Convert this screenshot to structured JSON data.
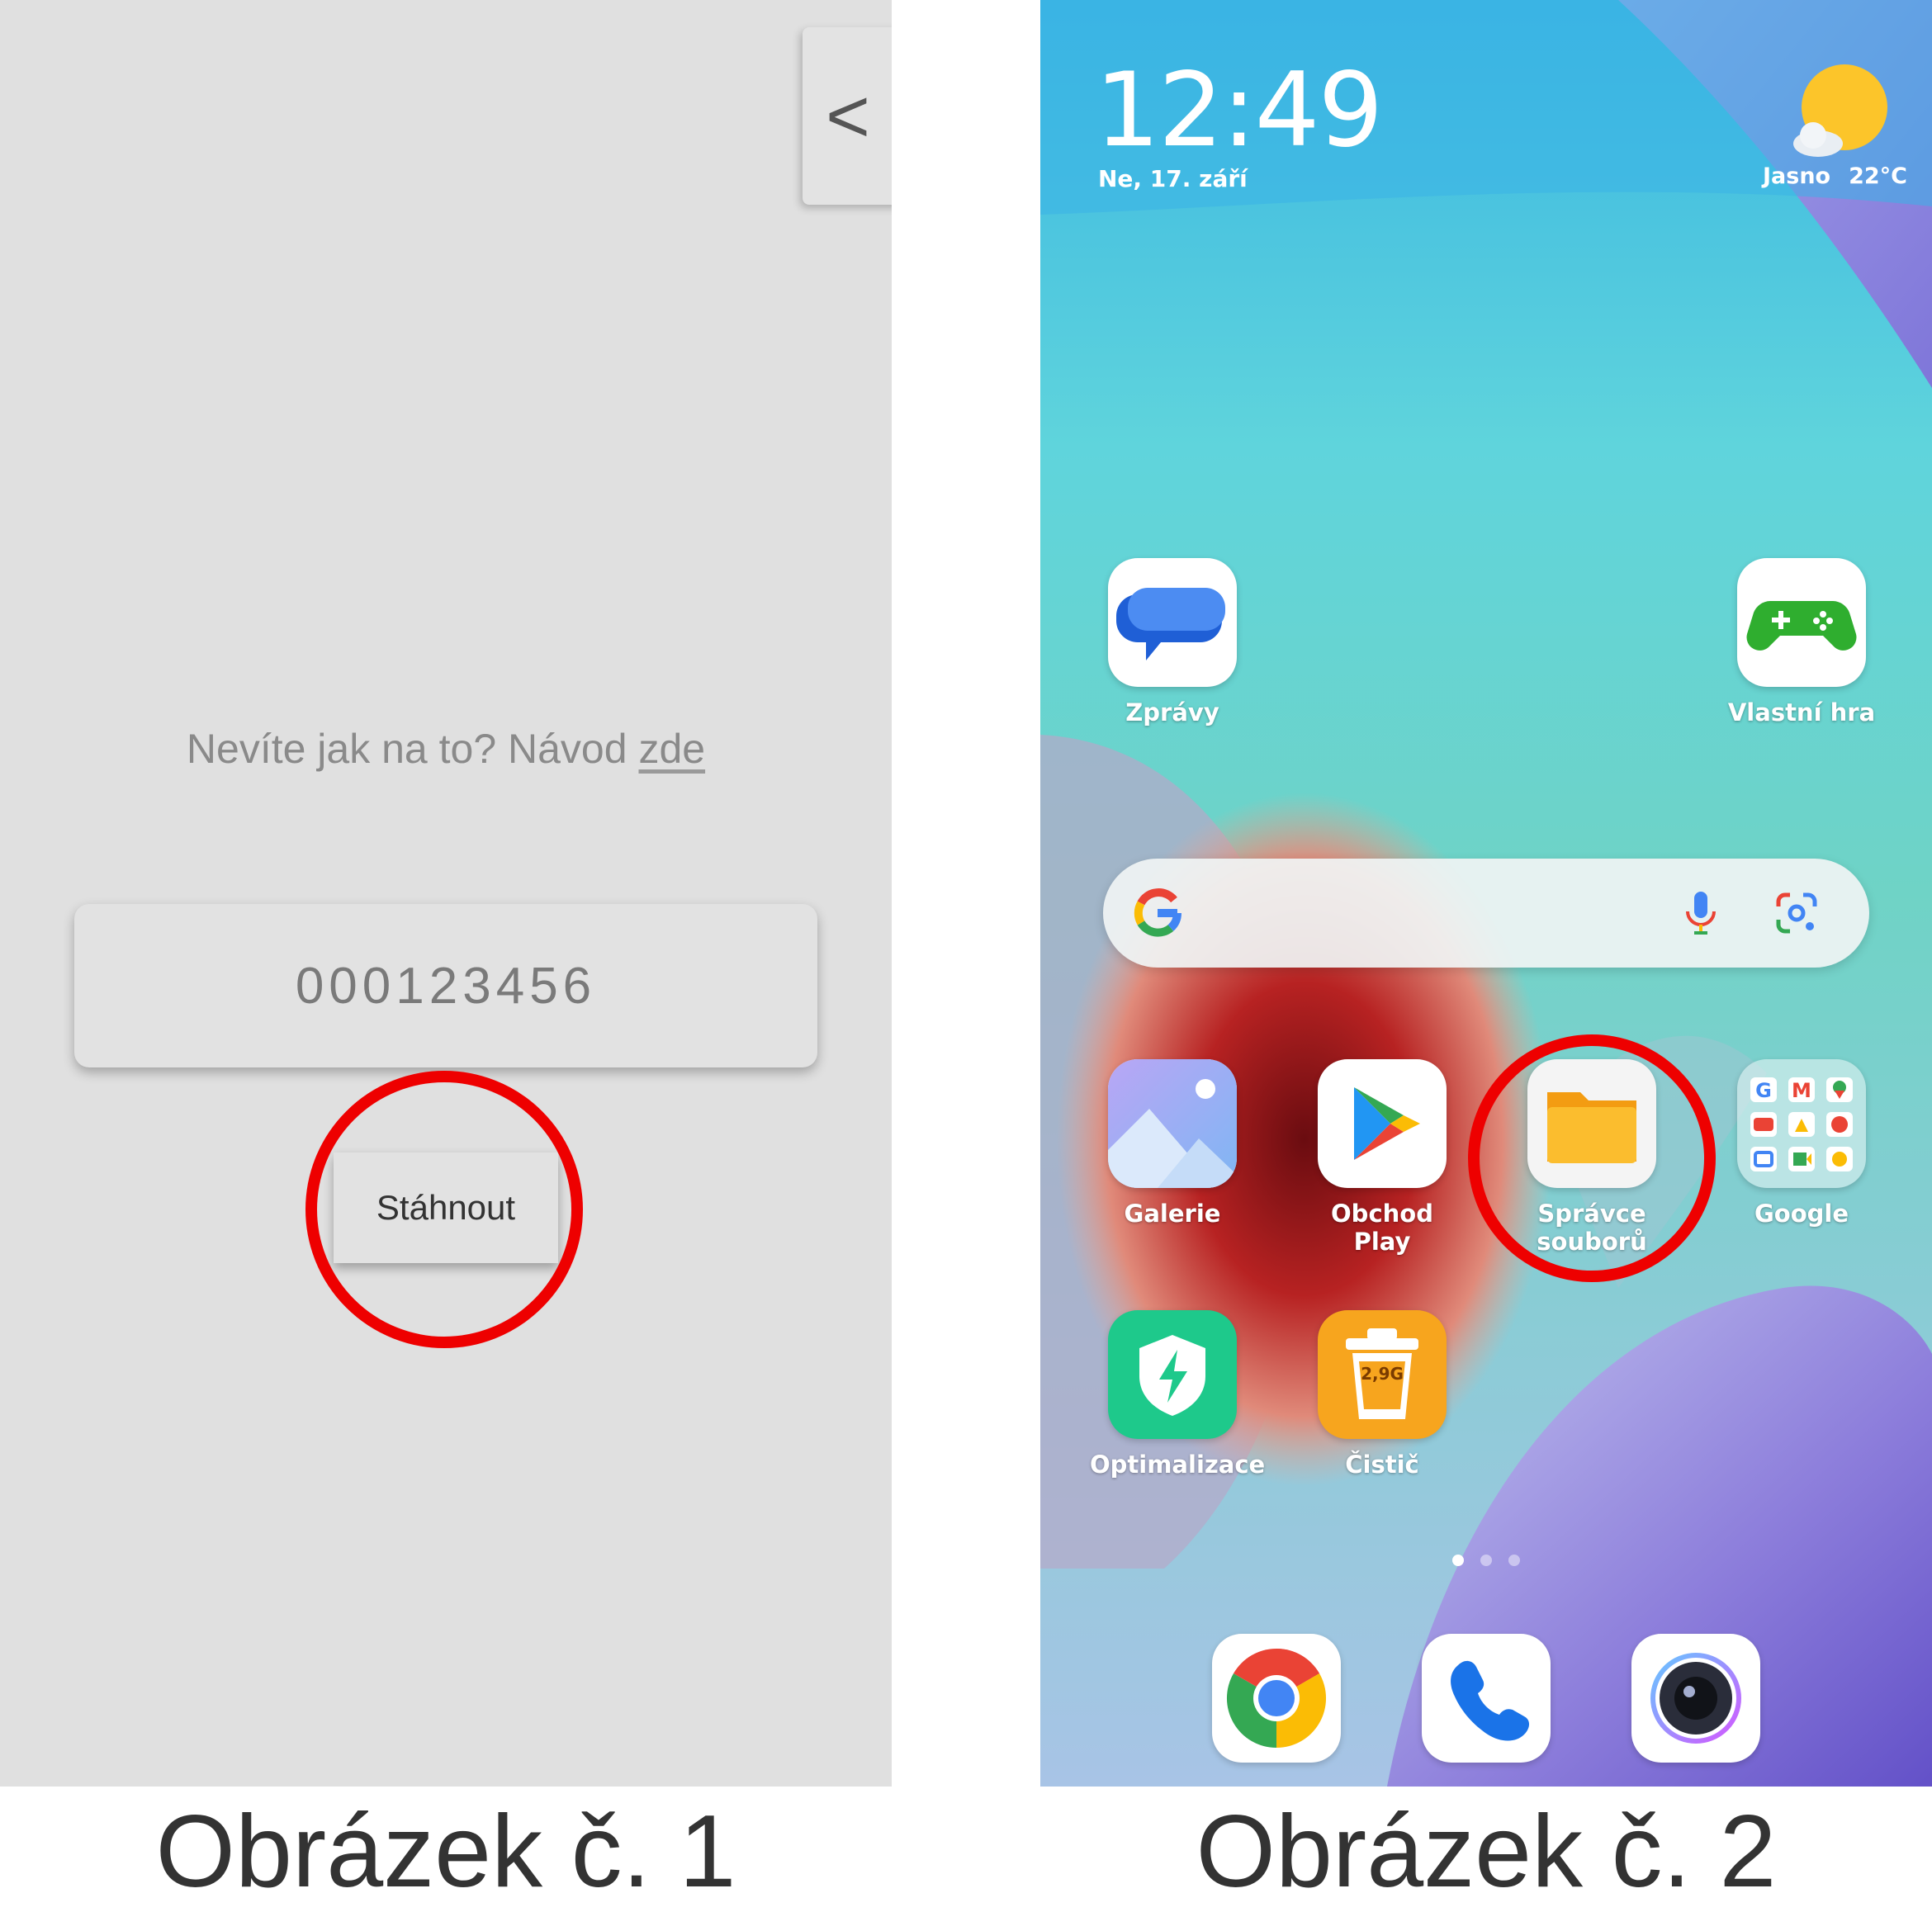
{
  "panel1": {
    "back_button": "<",
    "help_text": "Nevíte jak na to? Návod ",
    "help_link": "zde",
    "code_value": "000123456",
    "download_button": "Stáhnout",
    "highlight_color": "#ee0000",
    "caption": "Obrázek č. 1"
  },
  "panel2": {
    "status": {
      "time": "12:49",
      "date": "Ne, 17. září",
      "weather": "Jasno",
      "temperature": "22°C"
    },
    "apps_row1": [
      {
        "label": "Zprávy",
        "icon": "messages-icon"
      },
      {
        "label": "Vlastní hra",
        "icon": "gamepad-icon"
      }
    ],
    "search": {
      "icons": [
        "google-g-icon",
        "microphone-icon",
        "lens-icon"
      ]
    },
    "apps_row2": [
      {
        "label": "Galerie",
        "icon": "gallery-icon"
      },
      {
        "label": "Obchod Play",
        "icon": "play-store-icon"
      },
      {
        "label": "Správce souborů",
        "icon": "folder-icon"
      },
      {
        "label": "Google",
        "icon": "google-folder-icon"
      }
    ],
    "apps_row3": [
      {
        "label": "Optimalizace",
        "icon": "shield-bolt-icon"
      },
      {
        "label": "Čistič",
        "icon": "trash-icon",
        "badge": "2,9G"
      }
    ],
    "page_indicator": {
      "pages": 3,
      "active": 1
    },
    "dock": [
      "chrome-icon",
      "phone-icon",
      "camera-icon"
    ],
    "highlight_color": "#ee0000",
    "caption": "Obrázek č. 2"
  }
}
